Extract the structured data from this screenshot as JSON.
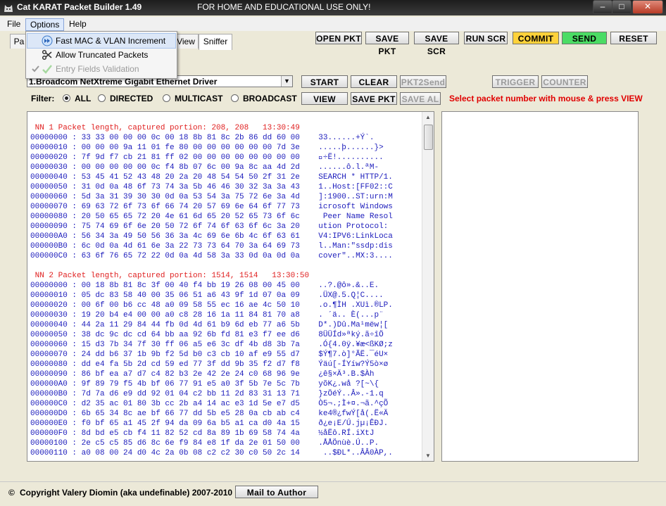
{
  "window": {
    "title": "Cat KARAT Packet Builder 1.49",
    "subtitle": "FOR HOME AND EDUCATIONAL USE ONLY!",
    "controls": {
      "minimize": "–",
      "maximize": "□",
      "close": "✕"
    }
  },
  "menubar": [
    {
      "label": "File"
    },
    {
      "label": "Options"
    },
    {
      "label": "Help"
    }
  ],
  "options_menu": [
    {
      "label": "Fast MAC & VLAN Increment",
      "icon": "fast-forward-icon",
      "enabled": true
    },
    {
      "label": "Allow Truncated Packets",
      "icon": "scissors-icon",
      "enabled": true
    },
    {
      "label": "Entry Fields Validation",
      "icon": "checkmark-icon",
      "enabled": false
    }
  ],
  "tabs": [
    {
      "label": "Pa"
    },
    {
      "label": "View"
    },
    {
      "label": "Sniffer"
    }
  ],
  "toolbar": {
    "open_pkt": "OPEN PKT",
    "save_pkt": "SAVE PKT",
    "save_scr": "SAVE SCR",
    "run_scr": "RUN SCR",
    "commit": "COMMIT",
    "send": "SEND",
    "reset": "RESET"
  },
  "sniffer": {
    "interface_value": "1.Broadcom NetXtreme Gigabit Ethernet Driver",
    "start": "START",
    "clear": "CLEAR",
    "pkt2send": "PKT2Send",
    "trigger": "TRIGGER",
    "counter": "COUNTER",
    "filter_label": "Filter:",
    "filter_options": [
      {
        "label": "ALL",
        "selected": true
      },
      {
        "label": "DIRECTED",
        "selected": false
      },
      {
        "label": "MULTICAST",
        "selected": false
      },
      {
        "label": "BROADCAST",
        "selected": false
      }
    ],
    "view": "VIEW",
    "save_pkt": "SAVE PKT",
    "save_al": "SAVE AL",
    "hint": "Select packet number with mouse & press VIEW"
  },
  "packets": [
    {
      "header": " NN 1 Packet length, captured portion: 208, 208   13:30:49",
      "lines": [
        {
          "off": "00000000",
          "hex": "33 33 00 00 00 0c 00 18 8b 81 8c 2b 86 dd 60 00",
          "ascii": "33......+Ý`."
        },
        {
          "off": "00000010",
          "hex": "00 00 00 9a 11 01 fe 80 00 00 00 00 00 00 7d 3e",
          "ascii": ".....þ......}>"
        },
        {
          "off": "00000020",
          "hex": "7f 9d f7 cb 21 81 ff 02 00 00 00 00 00 00 00 00",
          "ascii": "\u0000÷Ë!.........."
        },
        {
          "off": "00000030",
          "hex": "00 00 00 00 00 0c f4 8b 07 6c 00 9a 8c aa 4d 2d",
          "ascii": "......ô.l.ªM-"
        },
        {
          "off": "00000040",
          "hex": "53 45 41 52 43 48 20 2a 20 48 54 54 50 2f 31 2e",
          "ascii": "SEARCH * HTTP/1."
        },
        {
          "off": "00000050",
          "hex": "31 0d 0a 48 6f 73 74 3a 5b 46 46 30 32 3a 3a 43",
          "ascii": "1..Host:[FF02::C"
        },
        {
          "off": "00000060",
          "hex": "5d 3a 31 39 30 30 0d 0a 53 54 3a 75 72 6e 3a 4d",
          "ascii": "]:1900..ST:urn:M"
        },
        {
          "off": "00000070",
          "hex": "69 63 72 6f 73 6f 66 74 20 57 69 6e 64 6f 77 73",
          "ascii": "icrosoft Windows"
        },
        {
          "off": "00000080",
          "hex": "20 50 65 65 72 20 4e 61 6d 65 20 52 65 73 6f 6c",
          "ascii": " Peer Name Resol"
        },
        {
          "off": "00000090",
          "hex": "75 74 69 6f 6e 20 50 72 6f 74 6f 63 6f 6c 3a 20",
          "ascii": "ution Protocol: "
        },
        {
          "off": "000000A0",
          "hex": "56 34 3a 49 50 56 36 3a 4c 69 6e 6b 4c 6f 63 61",
          "ascii": "V4:IPV6:LinkLoca"
        },
        {
          "off": "000000B0",
          "hex": "6c 0d 0a 4d 61 6e 3a 22 73 73 64 70 3a 64 69 73",
          "ascii": "l..Man:\"ssdp:dis"
        },
        {
          "off": "000000C0",
          "hex": "63 6f 76 65 72 22 0d 0a 4d 58 3a 33 0d 0a 0d 0a",
          "ascii": "cover\"..MX:3...."
        }
      ]
    },
    {
      "header": " NN 2 Packet length, captured portion: 1514, 1514   13:30:50",
      "lines": [
        {
          "off": "00000000",
          "hex": "00 18 8b 81 8c 3f 00 40 f4 bb 19 26 08 00 45 00",
          "ascii": "..?.@ô».&..E."
        },
        {
          "off": "00000010",
          "hex": "05 dc 83 58 40 00 35 06 51 a6 43 9f 1d 07 0a 09",
          "ascii": ".ÜX@.5.Q¦C...."
        },
        {
          "off": "00000020",
          "hex": "00 6f 00 b6 cc 48 a0 09 58 55 ec 16 ae 4c 50 10",
          "ascii": ".o.¶ÌH .XUì.®LP."
        },
        {
          "off": "00000030",
          "hex": "19 20 b4 e4 00 00 a0 c8 28 16 1a 11 84 81 70 a8",
          "ascii": ". ´ä.. È(...p¨"
        },
        {
          "off": "00000040",
          "hex": "44 2a 11 29 84 44 fb 0d 4d 61 b9 6d eb 77 a6 5b",
          "ascii": "D*.)Dû.Ma¹mëw¦["
        },
        {
          "off": "00000050",
          "hex": "38 dc 9c dc cd 64 bb aa 92 6b fd 81 e3 f7 ee d6",
          "ascii": "8ÜÜÍd»ªký.ã÷îÖ"
        },
        {
          "off": "00000060",
          "hex": "15 d3 7b 34 7f 30 ff 06 a5 e6 3c df 4b d8 3b 7a",
          "ascii": ".Ó{4.0ÿ.¥æ<ßKØ;z"
        },
        {
          "off": "00000070",
          "hex": "24 dd b6 37 1b 9b f2 5d b0 c3 cb 10 af e9 55 d7",
          "ascii": "$Ý¶7.ò]°ÃË.¯éU×"
        },
        {
          "off": "00000080",
          "hex": "dd e4 fa 5b 2d cd 59 ed 77 3f dd 9b 35 f2 d7 f8",
          "ascii": "Ýäú[-ÍYíw?Ý5ò×ø"
        },
        {
          "off": "00000090",
          "hex": "86 bf ea a7 d7 c4 82 b3 2e 42 2e 24 c0 68 96 9e",
          "ascii": "¿ê§×Ä³.B.$Àh"
        },
        {
          "off": "000000A0",
          "hex": "9f 89 79 f5 4b bf 06 77 91 e5 a0 3f 5b 7e 5c 7b",
          "ascii": "yõK¿.wå ?[~\\{"
        },
        {
          "off": "000000B0",
          "hex": "7d 7a d6 e9 dd 92 01 04 c2 bb 11 2d 83 31 13 71",
          "ascii": "}zÖéÝ..Â».-1.q"
        },
        {
          "off": "000000C0",
          "hex": "d2 35 ac 01 80 3b cc 2b a4 14 ac e3 1d 5e e7 d5",
          "ascii": "Ò5¬.;Ì+¤.¬ã.^çÕ"
        },
        {
          "off": "000000D0",
          "hex": "6b 65 34 8c ae bf 66 77 dd 5b e5 28 0a cb ab c4",
          "ascii": "ke4®¿fwÝ[å(.Ë«Ä"
        },
        {
          "off": "000000E0",
          "hex": "f0 bf 65 a1 45 2f 94 da 09 6a b5 a1 ca d0 4a 15",
          "ascii": "ð¿e¡E/Ú.jµ¡ÊÐJ."
        },
        {
          "off": "000000F0",
          "hex": "8d bd e5 cb f4 11 82 52 cd 8a 89 1b 69 58 74 4a",
          "ascii": "½åËô.RÍ.iXtJ"
        },
        {
          "off": "00000100",
          "hex": "2e c5 c5 85 d6 8c 6e f9 84 e8 1f da 2e 01 50 00",
          "ascii": ".ÅÅÖnùè.Ú..P."
        },
        {
          "off": "00000110",
          "hex": "a0 08 00 24 d0 4c 2a 0b 08 c2 c2 30 c0 50 2c 14",
          "ascii": " ..$ÐL*..ÂÂ0ÀP,."
        }
      ]
    }
  ],
  "footer": {
    "copyright_symbol": "©",
    "copyright": "Copyright Valery Diomin (aka undefinable) 2007-2010",
    "mail": "Mail to Author"
  }
}
